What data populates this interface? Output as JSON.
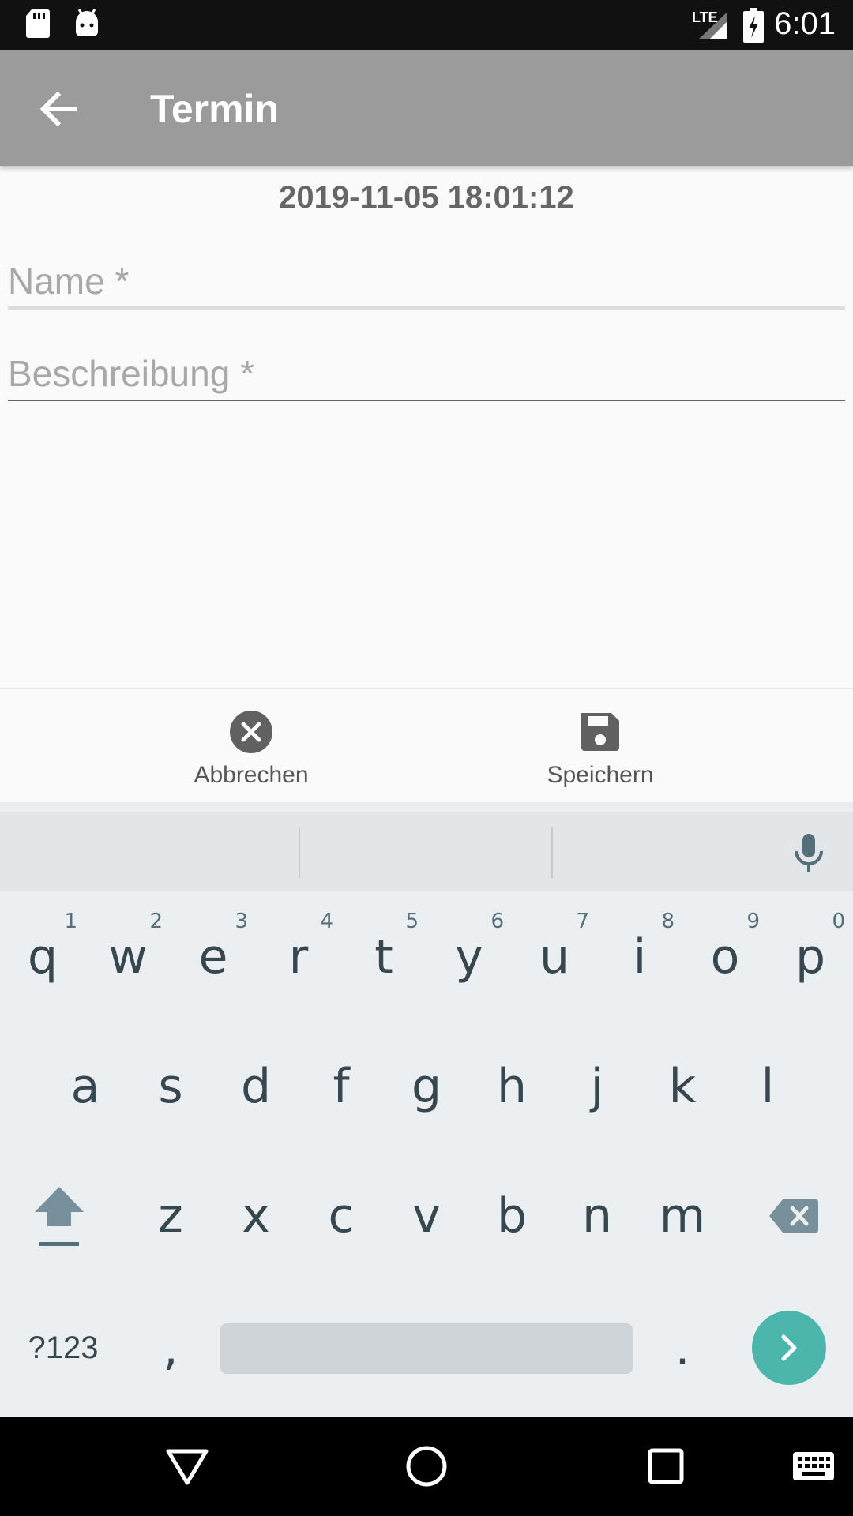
{
  "status_bar": {
    "time": "6:01",
    "network": "LTE",
    "icons": [
      "sd-card-icon",
      "android-debug-icon",
      "signal-icon",
      "battery-charging-icon"
    ]
  },
  "app_bar": {
    "title": "Termin",
    "back_icon": "arrow-left-icon"
  },
  "form": {
    "timestamp": "2019-11-05 18:01:12",
    "name_placeholder": "Name *",
    "name_value": "",
    "description_placeholder": "Beschreibung *",
    "description_value": ""
  },
  "actions": {
    "cancel_label": "Abbrechen",
    "cancel_icon": "cancel-circle-icon",
    "save_label": "Speichern",
    "save_icon": "floppy-disk-icon"
  },
  "keyboard": {
    "row1": [
      {
        "key": "q",
        "hint": "1"
      },
      {
        "key": "w",
        "hint": "2"
      },
      {
        "key": "e",
        "hint": "3"
      },
      {
        "key": "r",
        "hint": "4"
      },
      {
        "key": "t",
        "hint": "5"
      },
      {
        "key": "y",
        "hint": "6"
      },
      {
        "key": "u",
        "hint": "7"
      },
      {
        "key": "i",
        "hint": "8"
      },
      {
        "key": "o",
        "hint": "9"
      },
      {
        "key": "p",
        "hint": "0"
      }
    ],
    "row2": [
      "a",
      "s",
      "d",
      "f",
      "g",
      "h",
      "j",
      "k",
      "l"
    ],
    "row3": [
      "z",
      "x",
      "c",
      "v",
      "b",
      "n",
      "m"
    ],
    "symbols_label": "?123",
    "comma": ",",
    "period": ".",
    "accent_color": "#4db6ac"
  },
  "nav_bar": {
    "buttons": [
      "back-triangle-icon",
      "home-circle-icon",
      "recents-square-icon",
      "keyboard-switch-icon"
    ]
  }
}
